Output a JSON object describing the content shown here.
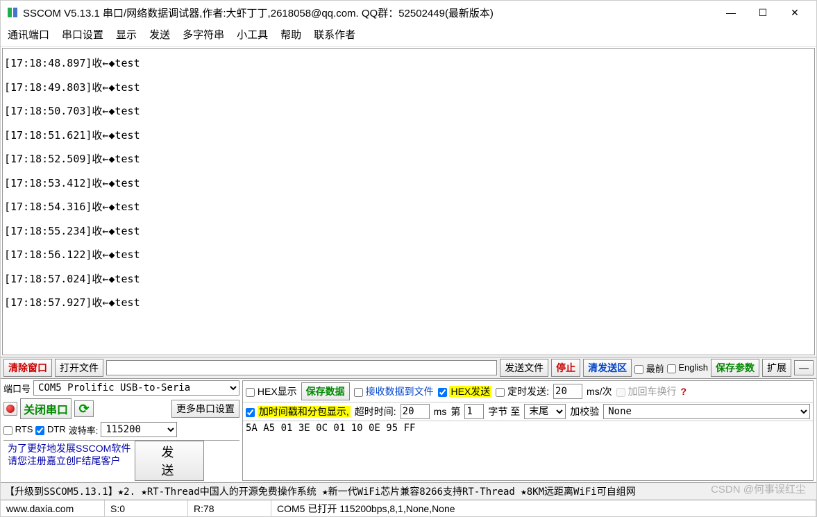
{
  "title": "SSCOM V5.13.1 串口/网络数据调试器,作者:大虾丁丁,2618058@qq.com. QQ群：52502449(最新版本)",
  "menu": [
    "通讯端口",
    "串口设置",
    "显示",
    "发送",
    "多字符串",
    "小工具",
    "帮助",
    "联系作者"
  ],
  "log_lines": [
    "[17:18:48.897]收←◆test",
    "[17:18:49.803]收←◆test",
    "[17:18:50.703]收←◆test",
    "[17:18:51.621]收←◆test",
    "[17:18:52.509]收←◆test",
    "[17:18:53.412]收←◆test",
    "[17:18:54.316]收←◆test",
    "[17:18:55.234]收←◆test",
    "[17:18:56.122]收←◆test",
    "[17:18:57.024]收←◆test",
    "[17:18:57.927]收←◆test"
  ],
  "row1": {
    "clear": "清除窗口",
    "openfile": "打开文件",
    "path": "",
    "sendfile": "发送文件",
    "stop": "停止",
    "clearsend": "清发送区",
    "topmost": "最前",
    "english": "English",
    "saveparam": "保存参数",
    "expand": "扩展",
    "minimize": "—"
  },
  "left": {
    "portlabel": "端口号",
    "port": "COM5 Prolific USB-to-Seria",
    "close": "关闭串口",
    "moresettings": "更多串口设置",
    "rts": "RTS",
    "dtr": "DTR",
    "baudlabel": "波特率:",
    "baud": "115200",
    "note1": "为了更好地发展SSCOM软件",
    "note2": "请您注册嘉立创F结尾客户",
    "send": "发 送"
  },
  "opts": {
    "hexshow": "HEX显示",
    "savedata": "保存数据",
    "recvtofile": "接收数据到文件",
    "hexsend": "HEX发送",
    "timed": "定时发送:",
    "timed_val": "20",
    "timed_unit": "ms/次",
    "addcr": "加回车换行",
    "addts": "加时间戳和分包显示,",
    "timeoutlabel": "超时时间:",
    "timeout": "20",
    "timeout_unit": "ms",
    "no_label": "第",
    "no": "1",
    "byte_to": "字节 至",
    "end": "末尾",
    "addcheck": "加校验",
    "check": "None"
  },
  "sendbuf": "5A A5 01 3E 0C 01 10 0E 95 FF",
  "ad": "【升级到SSCOM5.13.1】★2. ★RT-Thread中国人的开源免费操作系统 ★新一代WiFi芯片兼容8266支持RT-Thread ★8KM远距离WiFi可自组网",
  "status": {
    "url": "www.daxia.com",
    "s": "S:0",
    "r": "R:78",
    "com": "COM5 已打开 115200bps,8,1,None,None"
  },
  "watermark": "CSDN @何事误红尘"
}
